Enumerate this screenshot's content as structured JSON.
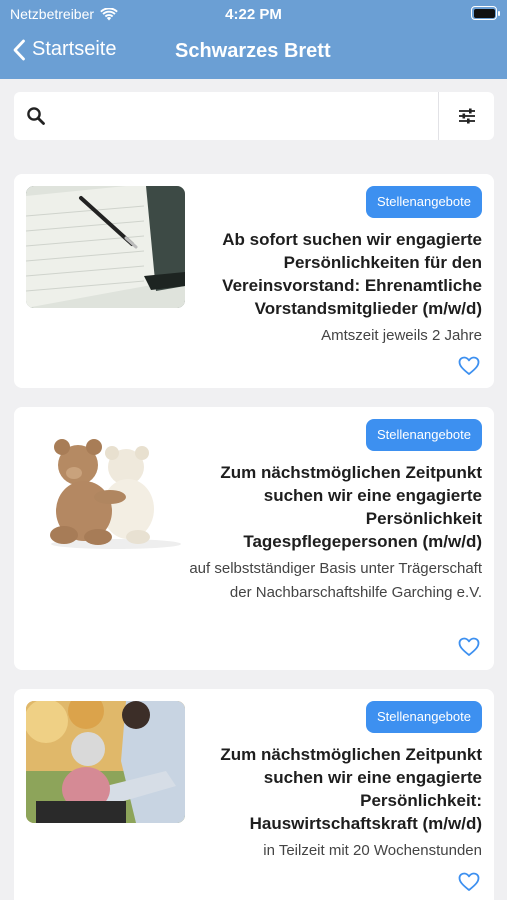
{
  "status_bar": {
    "carrier": "Netzbetreiber",
    "time": "4:22 PM"
  },
  "nav": {
    "back_label": "Startseite",
    "title": "Schwarzes Brett"
  },
  "search": {
    "value": "",
    "placeholder": ""
  },
  "posts": [
    {
      "badge": "Stellenangebote",
      "headline": "Ab sofort suchen wir engagierte Persönlichkeiten für den Vereinsvorstand: Ehrenamtliche Vorstandsmitglieder (m/w/d)",
      "sub": "Amtszeit jeweils 2 Jahre",
      "image": "notebook-pen"
    },
    {
      "badge": "Stellenangebote",
      "headline": "Zum nächstmöglichen Zeitpunkt suchen wir eine engagierte Persönlichkeit Tagespflegepersonen (m/w/d)",
      "sub": "auf selbstständiger Basis unter Trägerschaft der Nachbarschaftshilfe Garching e.V.",
      "image": "teddy-bears"
    },
    {
      "badge": "Stellenangebote",
      "headline": "Zum nächstmöglichen Zeitpunkt suchen wir eine engagierte Persönlichkeit: Hauswirtschaftskraft (m/w/d)",
      "sub": "in Teilzeit mit 20 Wochenstunden",
      "image": "caregiver-elderly"
    }
  ],
  "colors": {
    "header": "#6b9fd4",
    "badge": "#3d90f0",
    "background": "#f0f0f2"
  },
  "icons": [
    "wifi-icon",
    "battery-icon",
    "chevron-left-icon",
    "search-icon",
    "filter-icon",
    "heart-icon"
  ]
}
